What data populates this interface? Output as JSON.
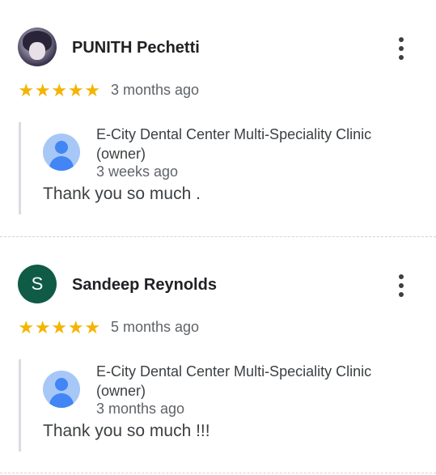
{
  "reviews": [
    {
      "reviewer": "PUNITH Pechetti",
      "avatar_letter": "",
      "rating": 5,
      "stars": [
        "★",
        "★",
        "★",
        "★",
        "★"
      ],
      "time": "3 months ago",
      "reply": {
        "owner_name": "E-City Dental Center Multi-Speciality Clinic (owner)",
        "time": "3 weeks ago",
        "text": "Thank you so much ."
      }
    },
    {
      "reviewer": "Sandeep Reynolds",
      "avatar_letter": "S",
      "rating": 5,
      "stars": [
        "★",
        "★",
        "★",
        "★",
        "★"
      ],
      "time": "5 months ago",
      "reply": {
        "owner_name": "E-City Dental Center Multi-Speciality Clinic (owner)",
        "time": "3 months ago",
        "text": "Thank you so much !!!"
      }
    }
  ],
  "colors": {
    "star": "#f4b400",
    "letter_avatar": "#0f5b46",
    "owner_avatar": "#4285f4"
  },
  "icons": {
    "menu": "more-vert-icon",
    "star": "star-icon",
    "owner_avatar": "person-icon"
  }
}
